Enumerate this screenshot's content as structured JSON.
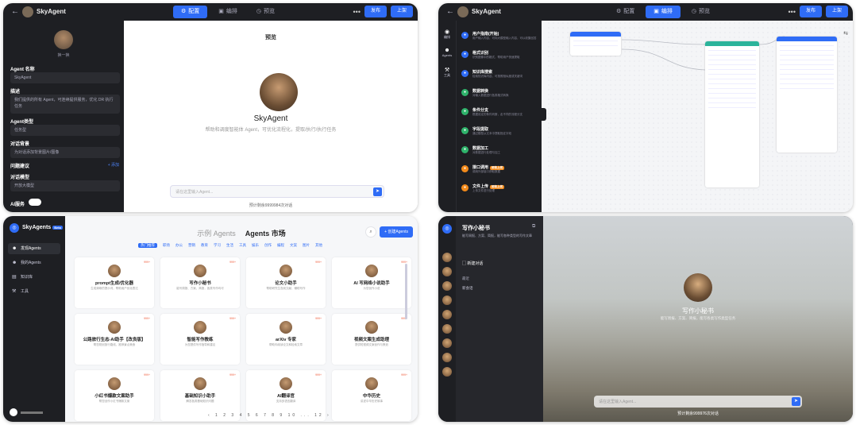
{
  "p1": {
    "app_title": "SkyAgent",
    "tabs": [
      "配置",
      "编排",
      "预览"
    ],
    "publish": "发布",
    "deploy": "上架",
    "change_avatar": "换一换",
    "agent_name_label": "Agent 名称",
    "agent_name_value": "SkyAgent",
    "desc_label": "描述",
    "desc_value": "我们提供的所有 Agent，可连续提供服务，优化 DR 执行任务",
    "type_label": "Agent类型",
    "type_value": "任务型",
    "bg_label": "对话背景",
    "bg_value": "为对话添加背景图片/图像",
    "guide_label": "问题建议",
    "guide_more": "+ 添加",
    "model_label": "对话模型",
    "model_value": "开放大模型",
    "ai_label": "AI服务",
    "preview_title": "预览",
    "agent_name": "SkyAgent",
    "agent_desc": "帮助和调度智能体 Agent，可优化流程化，提取/执行/执行任务",
    "chat_placeholder": "请在这里输入Agent...",
    "counter": "预计剩余9999984次对话"
  },
  "p2": {
    "app_title": "SkyAgent",
    "tabs": [
      "配置",
      "编排",
      "预览"
    ],
    "publish": "发布",
    "deploy": "上架",
    "rail": [
      "编排",
      "Agents",
      "工具"
    ],
    "nodes": [
      {
        "t": "用户指南(开始)",
        "d": "用户输入内容，可向大模型输入内容，可以收集回答",
        "c": "#2f6cf6"
      },
      {
        "t": "格式识别",
        "d": "识别图像中的格式，帮助用户快速提取",
        "c": "#2f6cf6"
      },
      {
        "t": "知识库搜索",
        "d": "检索知识库内容，可按照相似度或关键词",
        "c": "#2f6cf6"
      },
      {
        "t": "数据转换",
        "d": "对输入数据进行各类格式转换",
        "c": "#2fb36b"
      },
      {
        "t": "条件分支",
        "d": "根据设定的条件判断，走不同的流程分支",
        "c": "#2fb36b"
      },
      {
        "t": "字段提取",
        "d": "通过模型从文本中提取指定字段",
        "c": "#2fb36b"
      },
      {
        "t": "数据加工",
        "d": "对数据进行处理与加工",
        "c": "#2fb36b"
      },
      {
        "t": "接口调用",
        "d": "调用外部接口获取数据",
        "c": "#f28a1b",
        "badge": "即将上线"
      },
      {
        "t": "文件上传",
        "d": "上传文件进行处理",
        "c": "#f28a1b",
        "badge": "即将上线"
      }
    ]
  },
  "p3": {
    "brand": "SkyAgents",
    "beta": "Beta",
    "side": [
      "发现Agents",
      "我的Agents",
      "知识库",
      "工具"
    ],
    "title_ex": "示例 Agents",
    "title_mk": "Agents 市场",
    "create": "+ 创建Agents",
    "cats": [
      "热门推荐",
      "职场",
      "办公",
      "营销",
      "教育",
      "学习",
      "生活",
      "工具",
      "娱乐",
      "创作",
      "编程",
      "文案",
      "图片",
      "其他"
    ],
    "cards": [
      {
        "t": "prompt生成/优化器",
        "d": "生成清晰的提示词，帮助用户优化表达",
        "hot": "999+"
      },
      {
        "t": "写作小秘书",
        "d": "能写周报、方案、简报，各类写作均可",
        "hot": "999+"
      },
      {
        "t": "论文小助手",
        "d": "帮助研究生查阅文献，辅助写作",
        "hot": "999+"
      },
      {
        "t": "AI 写网络小说助手",
        "d": "为您创作小说",
        "hot": "999+"
      },
      {
        "t": "公路旅行生态-AI助手【改良版】",
        "d": "帮您规划旅行路线，推荐景点美食",
        "hot": "999+"
      },
      {
        "t": "智能写作教练",
        "d": "为您提供写作指导和建议",
        "hot": "999+"
      },
      {
        "t": "arXiv 专家",
        "d": "帮助你阅读论文和检索文章",
        "hot": "999+"
      },
      {
        "t": "视频文案生成助理",
        "d": "提供短视频文案创作与策划",
        "hot": "999+"
      },
      {
        "t": "小红书爆款文案助手",
        "d": "帮您创作小红书爆款文案",
        "hot": "999+"
      },
      {
        "t": "基础知识小助手",
        "d": "解答各类基础知识问题",
        "hot": "999+"
      },
      {
        "t": "AI翻译官",
        "d": "支持多语言翻译",
        "hot": "999+"
      },
      {
        "t": "中华历史",
        "d": "讲述中华历史故事",
        "hot": "999+"
      }
    ],
    "pager": "‹ 1 2 3 4 5 6 7 8 9 10 ... 12 ›"
  },
  "p4": {
    "title": "写作小秘书",
    "sub": "能写周报、方案、简报，能写各种类型的写作文章",
    "new_chat": "新建对话",
    "group": "最近",
    "conv": "新会话",
    "agent_name": "写作小秘书",
    "agent_desc": "能写周报、方案、简报，能写各类写作类型任务",
    "chat_placeholder": "请在这里输入Agent...",
    "counter": "预计剩余999976次对话"
  }
}
